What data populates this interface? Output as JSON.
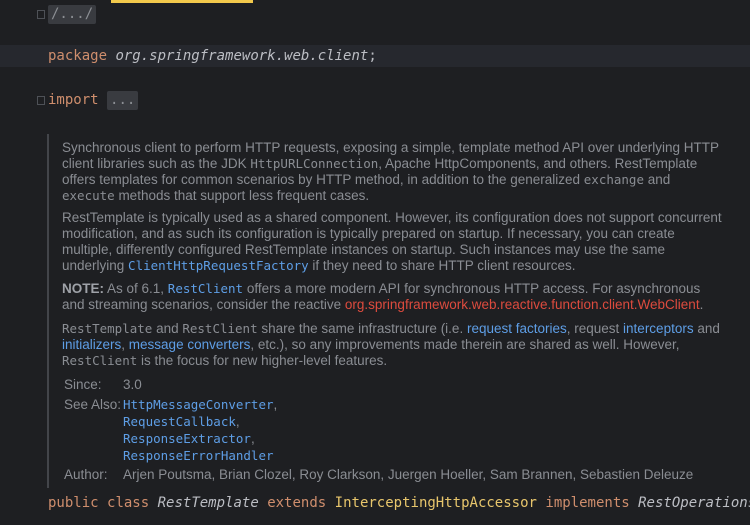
{
  "editor": {
    "header_fold": "/.../",
    "package_keyword": "package",
    "package_name": "org.springframework.web.client",
    "package_semicolon": ";",
    "import_keyword": "import",
    "import_fold": "...",
    "class_decl": {
      "public": "public",
      "class": "class",
      "name": "RestTemplate",
      "extends": "extends",
      "parent": "InterceptingHttpAccessor",
      "implements": "implements",
      "iface": "RestOperations",
      "brace": "{"
    }
  },
  "doc": {
    "p1": {
      "t1": "Synchronous client to perform HTTP requests, exposing a simple, template method API over underlying HTTP client libraries such as the JDK ",
      "c1": "HttpURLConnection",
      "t2": ", Apache HttpComponents, and others. RestTemplate offers templates for common scenarios by HTTP method, in addition to the generalized ",
      "c2": "exchange",
      "t3": " and ",
      "c3": "execute",
      "t4": " methods that support less frequent cases."
    },
    "p2": {
      "t1": "RestTemplate is typically used as a shared component. However, its configuration does not support concurrent modification, and as such its configuration is typically prepared on startup. If necessary, you can create multiple, differently configured RestTemplate instances on startup. Such instances may use the same underlying ",
      "link": "ClientHttpRequestFactory",
      "t2": " if they need to share HTTP client resources."
    },
    "p3": {
      "note": "NOTE:",
      "t1": " As of 6.1, ",
      "link": "RestClient",
      "t2": " offers a more modern API for synchronous HTTP access. For asynchronous and streaming scenarios, consider the reactive ",
      "red_link": "org.springframework.web.reactive.function.client.WebClient",
      "t3": "."
    },
    "p4": {
      "c1": "RestTemplate",
      "t1": " and ",
      "c2": "RestClient",
      "t2": " share the same infrastructure (i.e. ",
      "l1": "request factories",
      "t3": ", request ",
      "l2": "interceptors",
      "t4": " and ",
      "l3": "initializers",
      "t5": ", ",
      "l4": "message converters",
      "t6": ", etc.), so any improvements made therein are shared as well. However, ",
      "c3": "RestClient",
      "t7": " is the focus for new higher-level features."
    },
    "since_label": "Since:",
    "since_value": "3.0",
    "see_also_label": "See Also:",
    "see_also": [
      "HttpMessageConverter",
      "RequestCallback",
      "ResponseExtractor",
      "ResponseErrorHandler"
    ],
    "see_also_separators": [
      ",",
      ",",
      ",",
      ""
    ],
    "author_label": "Author:",
    "author_value": "Arjen Poutsma, Brian Clozel, Roy Clarkson, Juergen Hoeller, Sam Brannen, Sebastien Deleuze"
  }
}
